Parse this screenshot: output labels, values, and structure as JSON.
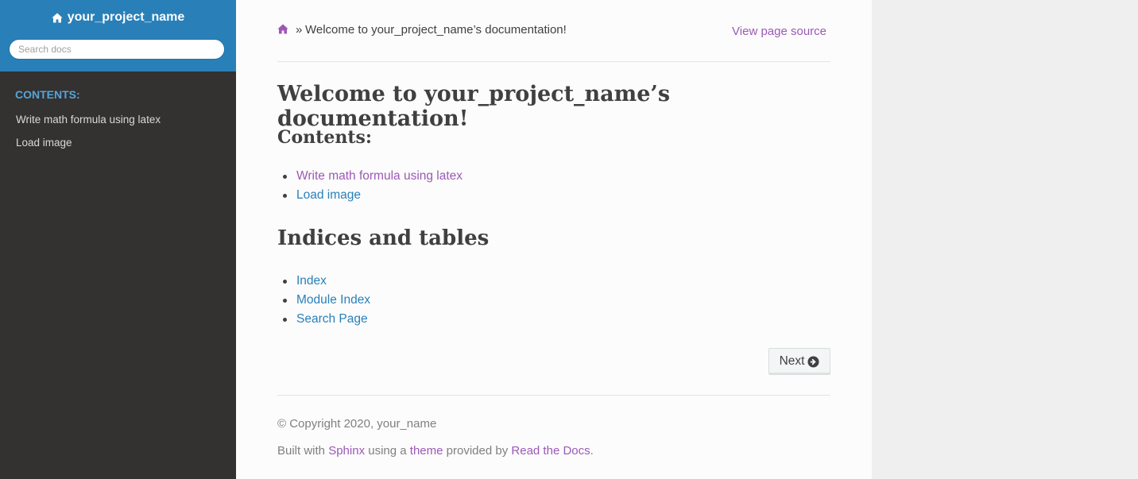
{
  "sidebar": {
    "project_name": "your_project_name",
    "search_placeholder": "Search docs",
    "caption": "CONTENTS:",
    "items": [
      {
        "label": "Write math formula using latex"
      },
      {
        "label": "Load image"
      }
    ]
  },
  "breadcrumbs": {
    "separator": "»",
    "current": "Welcome to your_project_name’s documentation!",
    "view_source": "View page source"
  },
  "main": {
    "title": "Welcome to your_project_name’s documentation!",
    "contents_heading": "Contents:",
    "contents_links": [
      {
        "label": "Write math formula using latex"
      },
      {
        "label": "Load image"
      }
    ],
    "indices_heading": "Indices and tables",
    "indices_links": [
      {
        "label": "Index"
      },
      {
        "label": "Module Index"
      },
      {
        "label": "Search Page"
      }
    ],
    "next_label": "Next"
  },
  "footer": {
    "copyright": "© Copyright 2020, your_name",
    "built_prefix": "Built with",
    "sphinx": "Sphinx",
    "using_a": "using a",
    "theme": "theme",
    "provided_by": "provided by",
    "rtd": "Read the Docs",
    "period": "."
  },
  "colors": {
    "sidebar_header": "#2980b9",
    "sidebar_bg": "#343131",
    "link_visited": "#9b59b6",
    "link": "#2980b9"
  },
  "icons": {
    "home": "home-icon",
    "next": "arrow-circle-right-icon"
  }
}
